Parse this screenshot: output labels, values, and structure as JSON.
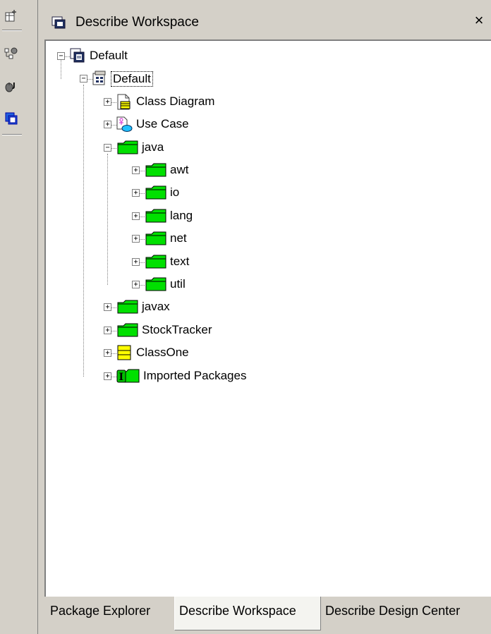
{
  "panel": {
    "title": "Describe Workspace",
    "close_glyph": "×"
  },
  "toolbar": {
    "buttons": [
      {
        "icon": "new-element-icon"
      },
      {
        "icon": "model-link-icon"
      },
      {
        "icon": "java-bean-icon"
      },
      {
        "icon": "workspace-icon"
      }
    ]
  },
  "tree": {
    "nodes": [
      {
        "label": "Default",
        "icon": "workspace-root-icon",
        "level": 0,
        "expanded": true
      },
      {
        "label": "Default",
        "icon": "model-icon",
        "level": 1,
        "expanded": true,
        "selected": true
      },
      {
        "label": "Class Diagram",
        "icon": "class-diagram-icon",
        "level": 2,
        "expanded": false
      },
      {
        "label": "Use Case",
        "icon": "use-case-icon",
        "level": 2,
        "expanded": false
      },
      {
        "label": "java",
        "icon": "folder-icon",
        "level": 2,
        "expanded": true
      },
      {
        "label": "awt",
        "icon": "folder-icon",
        "level": 3,
        "expanded": false
      },
      {
        "label": "io",
        "icon": "folder-icon",
        "level": 3,
        "expanded": false
      },
      {
        "label": "lang",
        "icon": "folder-icon",
        "level": 3,
        "expanded": false
      },
      {
        "label": "net",
        "icon": "folder-icon",
        "level": 3,
        "expanded": false
      },
      {
        "label": "text",
        "icon": "folder-icon",
        "level": 3,
        "expanded": false
      },
      {
        "label": "util",
        "icon": "folder-icon",
        "level": 3,
        "expanded": false
      },
      {
        "label": "javax",
        "icon": "folder-icon",
        "level": 2,
        "expanded": false
      },
      {
        "label": "StockTracker",
        "icon": "folder-icon",
        "level": 2,
        "expanded": false
      },
      {
        "label": "ClassOne",
        "icon": "class-icon",
        "level": 2,
        "expanded": false
      },
      {
        "label": "Imported Packages",
        "icon": "imported-packages-icon",
        "level": 2,
        "expanded": false
      }
    ]
  },
  "tabs": [
    {
      "label": "Package Explorer",
      "active": false
    },
    {
      "label": "Describe Workspace",
      "active": true
    },
    {
      "label": "Describe Design Center",
      "active": false
    }
  ],
  "colors": {
    "folder_green": "#00e000",
    "class_yellow": "#ffff00",
    "chrome": "#d4d0c8",
    "toolbar_blue": "#0000cc"
  }
}
